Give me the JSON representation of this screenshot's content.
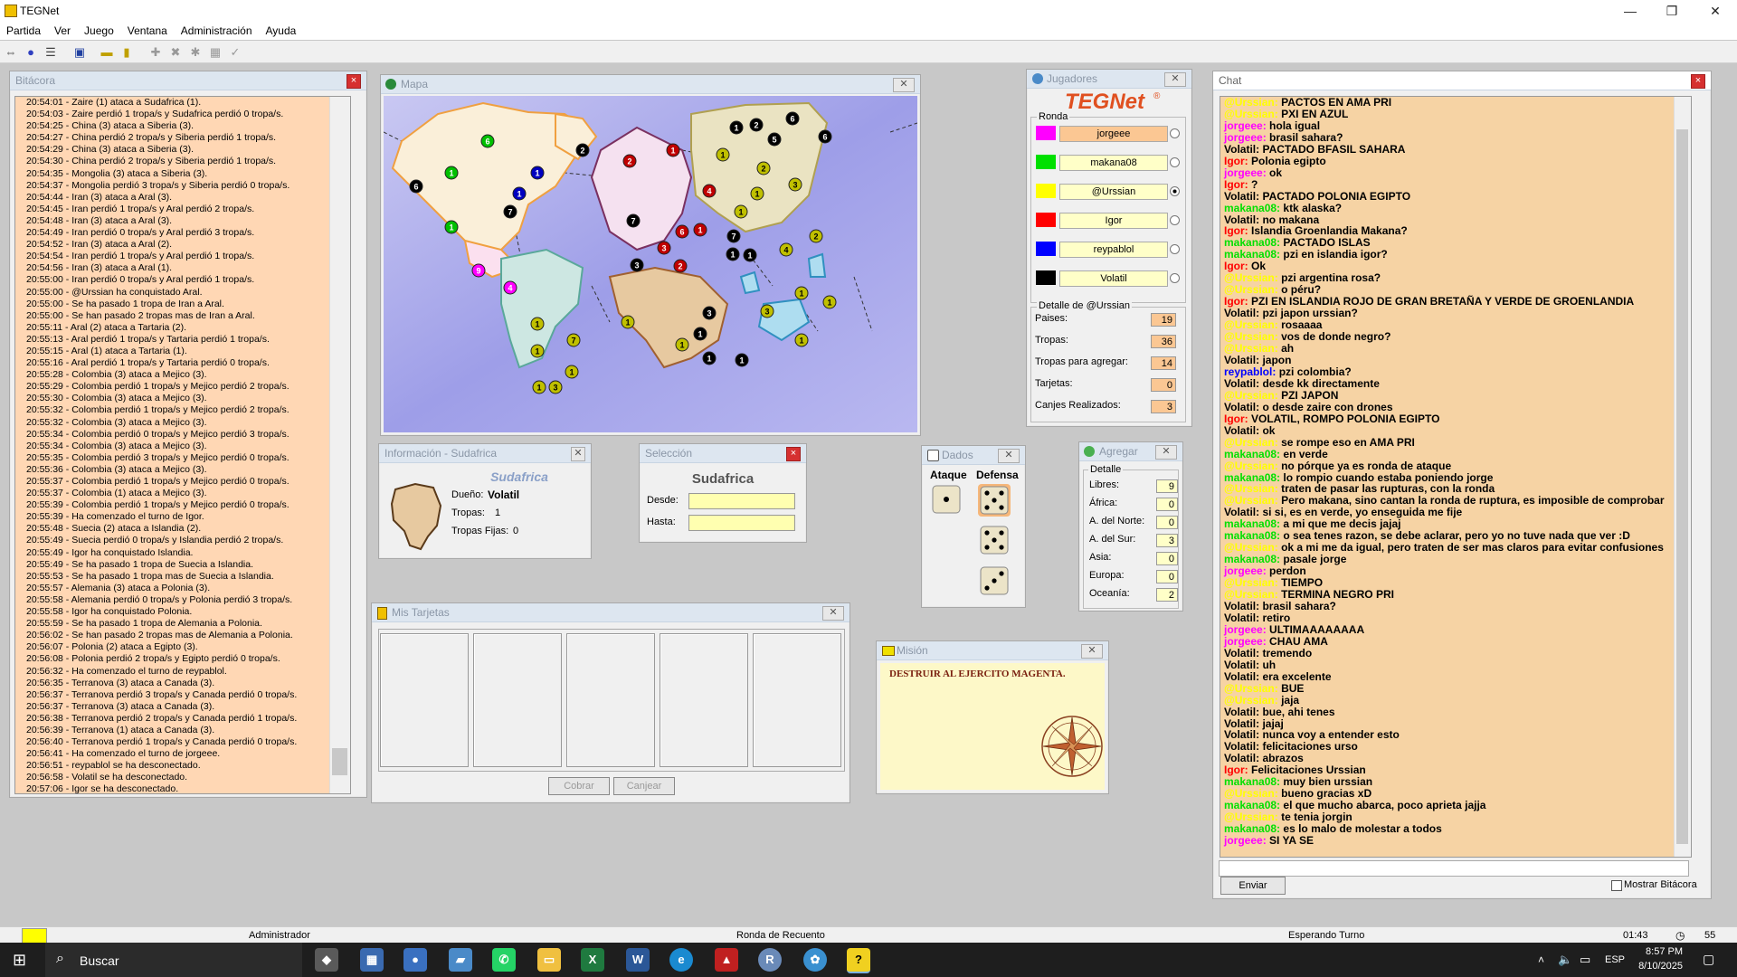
{
  "window": {
    "title": "TEGNet",
    "min": "—",
    "restore": "❐",
    "close": "✕"
  },
  "menu": [
    "Partida",
    "Ver",
    "Juego",
    "Ventana",
    "Administración",
    "Ayuda"
  ],
  "log": {
    "title": "Bitácora",
    "lines": [
      "20:54:01 - Zaire (1) ataca a Sudafrica (1).",
      "20:54:03 - Zaire perdió 1 tropa/s y Sudafrica perdió 0 tropa/s.",
      "20:54:25 - China (3) ataca a Siberia (3).",
      "20:54:27 - China perdió 2 tropa/s y Siberia perdió 1 tropa/s.",
      "20:54:29 - China (3) ataca a Siberia (3).",
      "20:54:30 - China perdió 2 tropa/s y Siberia perdió 1 tropa/s.",
      "20:54:35 - Mongolia (3) ataca a Siberia (3).",
      "20:54:37 - Mongolia perdió 3 tropa/s y Siberia perdió 0 tropa/s.",
      "20:54:44 - Iran (3) ataca a Aral (3).",
      "20:54:45 - Iran perdió 1 tropa/s y Aral perdió 2 tropa/s.",
      "20:54:48 - Iran (3) ataca a Aral (3).",
      "20:54:49 - Iran perdió 0 tropa/s y Aral perdió 3 tropa/s.",
      "20:54:52 - Iran (3) ataca a Aral (2).",
      "20:54:54 - Iran perdió 1 tropa/s y Aral perdió 1 tropa/s.",
      "20:54:56 - Iran (3) ataca a Aral (1).",
      "20:55:00 - Iran perdió 0 tropa/s y Aral perdió 1 tropa/s.",
      "20:55:00 - @Urssian ha conquistado Aral.",
      "20:55:00 - Se ha pasado 1 tropa de Iran a Aral.",
      "20:55:00 - Se han pasado 2 tropas mas de Iran a Aral.",
      "20:55:11 - Aral (2) ataca a Tartaria (2).",
      "20:55:13 - Aral perdió 1 tropa/s y Tartaria perdió 1 tropa/s.",
      "20:55:15 - Aral (1) ataca a Tartaria (1).",
      "20:55:16 - Aral perdió 1 tropa/s y Tartaria perdió 0 tropa/s.",
      "20:55:28 - Colombia (3) ataca a Mejico (3).",
      "20:55:29 - Colombia perdió 1 tropa/s y Mejico perdió 2 tropa/s.",
      "20:55:30 - Colombia (3) ataca a Mejico (3).",
      "20:55:32 - Colombia perdió 1 tropa/s y Mejico perdió 2 tropa/s.",
      "20:55:32 - Colombia (3) ataca a Mejico (3).",
      "20:55:34 - Colombia perdió 0 tropa/s y Mejico perdió 3 tropa/s.",
      "20:55:34 - Colombia (3) ataca a Mejico (3).",
      "20:55:35 - Colombia perdió 3 tropa/s y Mejico perdió 0 tropa/s.",
      "20:55:36 - Colombia (3) ataca a Mejico (3).",
      "20:55:37 - Colombia perdió 1 tropa/s y Mejico perdió 0 tropa/s.",
      "20:55:37 - Colombia (1) ataca a Mejico (3).",
      "20:55:39 - Colombia perdió 1 tropa/s y Mejico perdió 0 tropa/s.",
      "20:55:39 - Ha comenzado el turno de Igor.",
      "20:55:48 - Suecia (2) ataca a Islandia (2).",
      "20:55:49 - Suecia perdió 0 tropa/s y Islandia perdió 2 tropa/s.",
      "20:55:49 - Igor ha conquistado Islandia.",
      "20:55:49 - Se ha pasado 1 tropa de Suecia a Islandia.",
      "20:55:53 - Se ha pasado 1 tropa mas de Suecia a Islandia.",
      "20:55:57 - Alemania (3) ataca a Polonia (3).",
      "20:55:58 - Alemania perdió 0 tropa/s y Polonia perdió 3 tropa/s.",
      "20:55:58 - Igor ha conquistado Polonia.",
      "20:55:59 - Se ha pasado 1 tropa de Alemania a Polonia.",
      "20:56:02 - Se han pasado 2 tropas mas de Alemania a Polonia.",
      "20:56:07 - Polonia (2) ataca a Egipto (3).",
      "20:56:08 - Polonia perdió 2 tropa/s y Egipto perdió 0 tropa/s.",
      "20:56:32 - Ha comenzado el turno de reypablol.",
      "20:56:35 - Terranova (3) ataca a Canada (3).",
      "20:56:37 - Terranova perdió 3 tropa/s y Canada perdió 0 tropa/s.",
      "20:56:37 - Terranova (3) ataca a Canada (3).",
      "20:56:38 - Terranova perdió 2 tropa/s y Canada perdió 1 tropa/s.",
      "20:56:39 - Terranova (1) ataca a Canada (3).",
      "20:56:40 - Terranova perdió 1 tropa/s y Canada perdió 0 tropa/s.",
      "20:56:41 - Ha comenzado el turno de jorgeee.",
      "20:56:51 - reypablol se ha desconectado.",
      "20:56:58 - Volatil se ha desconectado.",
      "20:57:06 - Igor se ha desconectado."
    ]
  },
  "map": {
    "title": "Mapa"
  },
  "info": {
    "title": "Información - Sudafrica",
    "country": "Sudafrica",
    "owner_label": "Dueño:",
    "owner": "Volatil",
    "troops_label": "Tropas:",
    "troops": "1",
    "fixed_label": "Tropas Fijas:",
    "fixed": "0"
  },
  "selection": {
    "title": "Selección",
    "country": "Sudafrica",
    "from_label": "Desde:",
    "to_label": "Hasta:"
  },
  "cards": {
    "title": "Mis Tarjetas",
    "collect": "Cobrar",
    "exchange": "Canjear"
  },
  "dice": {
    "title": "Dados",
    "attack": "Ataque",
    "defense": "Defensa"
  },
  "mission": {
    "title": "Misión",
    "text": "DESTRUIR AL EJERCITO MAGENTA."
  },
  "players": {
    "title": "Jugadores",
    "logo": "TEGNet",
    "round_label": "Ronda",
    "list": [
      {
        "name": "jorgeee",
        "color": "#ff00ff"
      },
      {
        "name": "makana08",
        "color": "#00e000"
      },
      {
        "name": "@Urssian",
        "color": "#ffff00"
      },
      {
        "name": "Igor",
        "color": "#ff0000"
      },
      {
        "name": "reypablol",
        "color": "#0000ff"
      },
      {
        "name": "Volatil",
        "color": "#000000"
      }
    ],
    "detail_title": "Detalle de @Urssian",
    "detail": [
      {
        "label": "Paises:",
        "value": "19"
      },
      {
        "label": "Tropas:",
        "value": "36"
      },
      {
        "label": "Tropas para agregar:",
        "value": "14"
      },
      {
        "label": "Tarjetas:",
        "value": "0"
      },
      {
        "label": "Canjes Realizados:",
        "value": "3"
      }
    ]
  },
  "add": {
    "title": "Agregar",
    "detail_label": "Detalle",
    "rows": [
      {
        "label": "Libres:",
        "value": "9"
      },
      {
        "label": "África:",
        "value": "0"
      },
      {
        "label": "A. del Norte:",
        "value": "0"
      },
      {
        "label": "A. del Sur:",
        "value": "3"
      },
      {
        "label": "Asia:",
        "value": "0"
      },
      {
        "label": "Europa:",
        "value": "0"
      },
      {
        "label": "Oceanía:",
        "value": "2"
      }
    ]
  },
  "chat": {
    "title": "Chat",
    "send": "Enviar",
    "show_log": "Mostrar Bitácora",
    "colors": {
      "@Urssian": "#ffff00",
      "jorgeee": "#ff00ff",
      "Volatil": "#000000",
      "Igor": "#ff0000",
      "makana08": "#00e000",
      "reypablol": "#0000ff"
    },
    "messages": [
      {
        "who": "@Urssian",
        "text": "PACTOS EN AMA PRI"
      },
      {
        "who": "@Urssian",
        "text": "PXI EN AZUL"
      },
      {
        "who": "jorgeee",
        "text": "hola igual"
      },
      {
        "who": "jorgeee",
        "text": "brasil sahara?"
      },
      {
        "who": "Volatil",
        "text": "PACTADO BFASIL SAHARA"
      },
      {
        "who": "Igor",
        "text": "Polonia egipto"
      },
      {
        "who": "jorgeee",
        "text": "ok"
      },
      {
        "who": "Igor",
        "text": "?"
      },
      {
        "who": "Volatil",
        "text": "PACTADO POLONIA EGIPTO"
      },
      {
        "who": "makana08",
        "text": "ktk alaska?"
      },
      {
        "who": "Volatil",
        "text": "no makana"
      },
      {
        "who": "Igor",
        "text": "Islandia Groenlandia Makana?"
      },
      {
        "who": "makana08",
        "text": "PACTADO ISLAS"
      },
      {
        "who": "makana08",
        "text": "pzi en islandia igor?"
      },
      {
        "who": "Igor",
        "text": "Ok"
      },
      {
        "who": "@Urssian",
        "text": "pzi argentina rosa?"
      },
      {
        "who": "@Urssian",
        "text": "o péru?"
      },
      {
        "who": "Igor",
        "text": "PZI EN ISLANDIA ROJO DE GRAN BRETAÑA Y VERDE DE GROENLANDIA"
      },
      {
        "who": "Volatil",
        "text": "pzi japon urssian?"
      },
      {
        "who": "@Urssian",
        "text": "rosaaaa"
      },
      {
        "who": "@Urssian",
        "text": "vos de donde negro?"
      },
      {
        "who": "@Urssian",
        "text": "ah"
      },
      {
        "who": "Volatil",
        "text": "japon"
      },
      {
        "who": "reypablol",
        "text": "pzi colombia?"
      },
      {
        "who": "Volatil",
        "text": "desde kk directamente"
      },
      {
        "who": "@Urssian",
        "text": "PZI JAPON"
      },
      {
        "who": "Volatil",
        "text": "o desde zaire con drones"
      },
      {
        "who": "Igor",
        "text": "VOLATIL, ROMPO POLONIA EGIPTO"
      },
      {
        "who": "Volatil",
        "text": "ok"
      },
      {
        "who": "@Urssian",
        "text": "se rompe eso en AMA PRI"
      },
      {
        "who": "makana08",
        "text": "en verde"
      },
      {
        "who": "@Urssian",
        "text": "no pórque ya es ronda de ataque"
      },
      {
        "who": "makana08",
        "text": "lo rompio cuando estaba poniendo jorge"
      },
      {
        "who": "@Urssian",
        "text": "traten de pasar las rupturas, con la ronda"
      },
      {
        "who": "@Urssian",
        "text": "Pero makana, sino cantan la ronda de ruptura, es imposible de comprobar"
      },
      {
        "who": "Volatil",
        "text": "si si, es en verde, yo enseguida me fije"
      },
      {
        "who": "makana08",
        "text": "a mi que me decis jajaj"
      },
      {
        "who": "makana08",
        "text": "o sea tenes razon, se debe aclarar, pero yo no tuve nada que ver :D"
      },
      {
        "who": "@Urssian",
        "text": "ok a mi me da igual, pero traten de ser mas claros para evitar confusiones"
      },
      {
        "who": "makana08",
        "text": "pasale jorge"
      },
      {
        "who": "jorgeee",
        "text": "perdon"
      },
      {
        "who": "@Urssian",
        "text": "TIEMPO"
      },
      {
        "who": "@Urssian",
        "text": "TERMINA NEGRO PRI"
      },
      {
        "who": "Volatil",
        "text": "brasil sahara?"
      },
      {
        "who": "Volatil",
        "text": "retiro"
      },
      {
        "who": "jorgeee",
        "text": "ULTIMAAAAAAAA"
      },
      {
        "who": "jorgeee",
        "text": "CHAU AMA"
      },
      {
        "who": "Volatil",
        "text": "tremendo"
      },
      {
        "who": "Volatil",
        "text": "uh"
      },
      {
        "who": "Volatil",
        "text": "era excelente"
      },
      {
        "who": "@Urssian",
        "text": "BUE"
      },
      {
        "who": "@Urssian",
        "text": "jaja"
      },
      {
        "who": "Volatil",
        "text": "bue, ahi tenes"
      },
      {
        "who": "Volatil",
        "text": "jajaj"
      },
      {
        "who": "Volatil",
        "text": "nunca voy a entender esto"
      },
      {
        "who": "Volatil",
        "text": "felicitaciones urso"
      },
      {
        "who": "Volatil",
        "text": "abrazos"
      },
      {
        "who": "Igor",
        "text": "Felicitaciones Urssian"
      },
      {
        "who": "makana08",
        "text": "muy bien urssian"
      },
      {
        "who": "@Urssian",
        "text": "bueno gracias xD"
      },
      {
        "who": "makana08",
        "text": "el que mucho abarca, poco aprieta jajja"
      },
      {
        "who": "@Urssian",
        "text": "te tenia jorgin"
      },
      {
        "who": "makana08",
        "text": "es lo malo de molestar a todos"
      },
      {
        "who": "jorgeee",
        "text": "SI YA SE"
      }
    ]
  },
  "status": {
    "user": "Administrador",
    "phase": "Ronda de Recuento",
    "state": "Esperando Turno",
    "timer": "01:43",
    "count": "55"
  },
  "taskbar": {
    "search": "Buscar",
    "lang": "ESP",
    "time": "8:57 PM",
    "date": "8/10/2025"
  }
}
